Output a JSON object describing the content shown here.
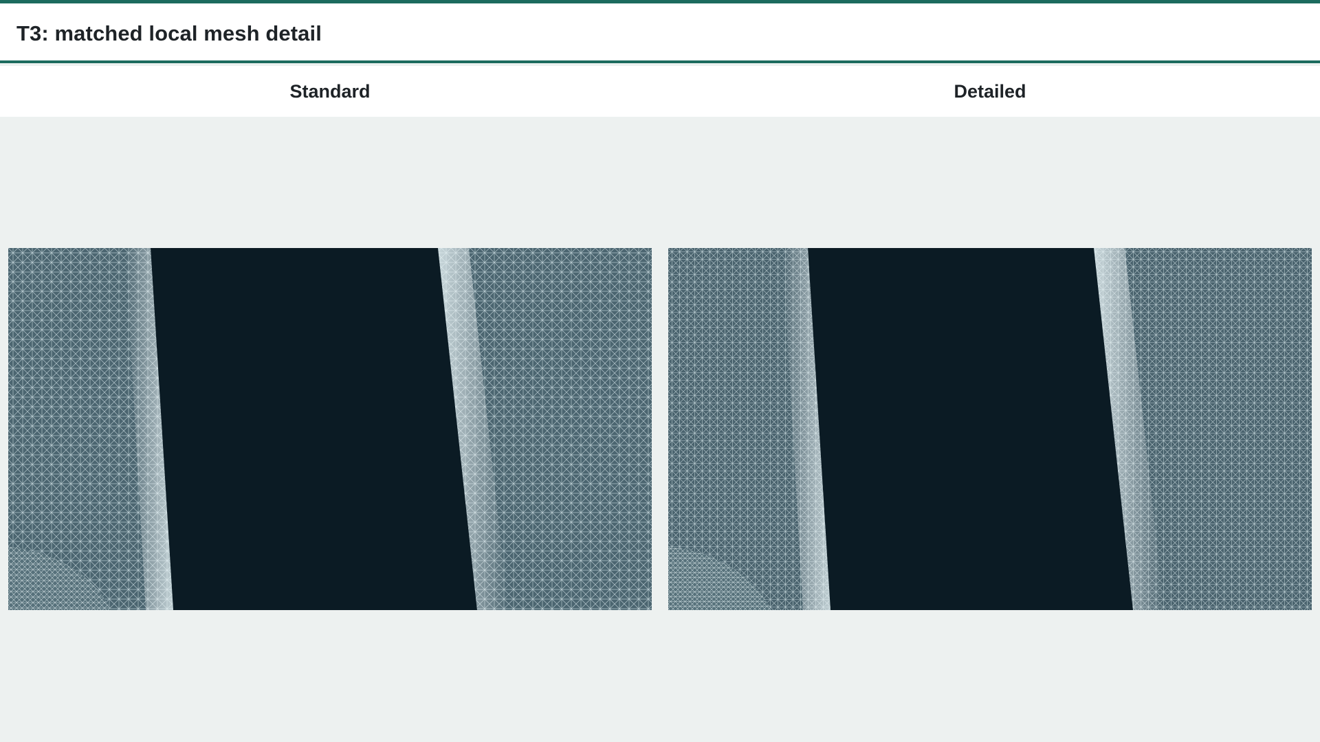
{
  "header": {
    "title": "T3: matched local mesh detail"
  },
  "panels": [
    {
      "label": "Standard",
      "view": "wireframe-mesh-viewport"
    },
    {
      "label": "Detailed",
      "view": "wireframe-mesh-viewport"
    }
  ],
  "colors": {
    "accent": "#1c6b5e",
    "page_background": "#edf1f0",
    "viewport_background": "#0b1b24",
    "mesh_line": "#dfeef0",
    "title_text": "#1e2327"
  }
}
